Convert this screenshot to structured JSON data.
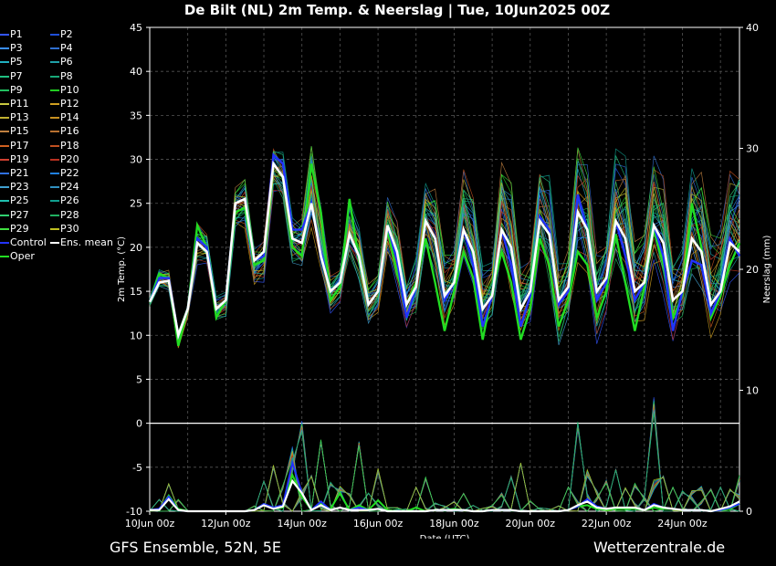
{
  "title": "De Bilt  (NL)  2m Temp. & Neerslag | Tue, 10Jun2025 00Z",
  "footer": {
    "left": "GFS Ensemble, 52N, 5E",
    "right": "Wetterzentrale.de"
  },
  "legend": [
    "P1",
    "P2",
    "P3",
    "P4",
    "P5",
    "P6",
    "P7",
    "P8",
    "P9",
    "P10",
    "P11",
    "P12",
    "P13",
    "P14",
    "P15",
    "P16",
    "P17",
    "P18",
    "P19",
    "P20",
    "P21",
    "P22",
    "P23",
    "P24",
    "P25",
    "P26",
    "P27",
    "P28",
    "P29",
    "P30",
    "Control",
    "Ens. mean",
    "Oper"
  ],
  "legend_colors": [
    "#3355ff",
    "#1f4fd8",
    "#3a8fff",
    "#2f6fd0",
    "#20b0c0",
    "#1fa0a8",
    "#20c080",
    "#18a878",
    "#22c060",
    "#22cc22",
    "#c8c840",
    "#d0a020",
    "#c0b030",
    "#c89020",
    "#c08040",
    "#b87030",
    "#d06020",
    "#c05020",
    "#d04030",
    "#b83020",
    "#3070e0",
    "#2080e0",
    "#40a0d0",
    "#3090c0",
    "#20c0b0",
    "#10a090",
    "#30d070",
    "#20b060",
    "#40e040",
    "#c0c020",
    "#2233ff",
    "#ffffff",
    "#22dd22"
  ],
  "chart_data": {
    "type": "line",
    "xlabel": "Date (UTC)",
    "ylabel": "2m Temp. (°C)",
    "y2label": "Neerslag (mm)",
    "ylim": [
      -10,
      45
    ],
    "y2lim": [
      0,
      40
    ],
    "yticks": [
      "-10",
      "-5",
      "0",
      "5",
      "10",
      "15",
      "20",
      "25",
      "30",
      "35",
      "40",
      "45"
    ],
    "y2ticks": [
      "0",
      "10",
      "20",
      "30",
      "40"
    ],
    "xlim": [
      0,
      15.5
    ],
    "xticks": [
      {
        "day": 0,
        "label": "10Jun 00z"
      },
      {
        "day": 2,
        "label": "12Jun 00z"
      },
      {
        "day": 4,
        "label": "14Jun 00z"
      },
      {
        "day": 6,
        "label": "16Jun 00z"
      },
      {
        "day": 8,
        "label": "18Jun 00z"
      },
      {
        "day": 10,
        "label": "20Jun 00z"
      },
      {
        "day": 12,
        "label": "22Jun 00z"
      },
      {
        "day": 14,
        "label": "24Jun 00z"
      }
    ],
    "grid": true,
    "legend_position": "left outside",
    "step_hours": 6,
    "temp_ens_mean": [
      13.8,
      16,
      16.2,
      10,
      13,
      20.5,
      19.5,
      13,
      14,
      25,
      25.5,
      18.5,
      19.5,
      29.5,
      28,
      21,
      20.5,
      25,
      19,
      15,
      16,
      21.5,
      19,
      13.5,
      15,
      22.5,
      19.5,
      13.5,
      15.5,
      23,
      21,
      14.5,
      16,
      22,
      19.5,
      13,
      14.5,
      22,
      20,
      13,
      15,
      23,
      21.5,
      14,
      15.5,
      24,
      22,
      15,
      16.5,
      23,
      21,
      15,
      16,
      22.5,
      20.5,
      14,
      15,
      21,
      19.5,
      13.5,
      15,
      20.5,
      19.5
    ],
    "temp_control": [
      13.8,
      16.5,
      16.5,
      10,
      13,
      21,
      20,
      13,
      14,
      25,
      25.5,
      18.5,
      19,
      30.5,
      29.5,
      22,
      22,
      25,
      19.5,
      15,
      16,
      21.5,
      19,
      13.5,
      15,
      22.5,
      18.5,
      12,
      15.5,
      23,
      21,
      14,
      16,
      22,
      18,
      11,
      14.5,
      22,
      18,
      11,
      14.5,
      23.5,
      22,
      13.5,
      15,
      26,
      22,
      14,
      16,
      23,
      19,
      14,
      16,
      22.5,
      19,
      10.5,
      15,
      18.5,
      18,
      12.5,
      15,
      21,
      19
    ],
    "temp_oper": [
      13.8,
      17,
      16.5,
      8.8,
      13,
      22.5,
      20,
      12,
      14,
      24,
      24.5,
      18,
      18.5,
      29.5,
      28,
      20,
      19,
      29.5,
      24,
      14,
      15.5,
      25.5,
      18.5,
      13.5,
      15,
      22,
      17,
      13.5,
      16,
      21,
      16,
      10.5,
      15,
      19.5,
      16.5,
      9.5,
      15,
      19.5,
      16,
      9.5,
      13,
      21,
      18,
      11,
      14,
      19.5,
      18,
      12,
      15,
      21.5,
      16,
      10.5,
      15.5,
      22,
      18,
      12,
      14.5,
      25,
      20,
      12,
      14.5,
      18,
      20.5
    ],
    "temp_env_min": [
      13.2,
      15.5,
      15,
      8.5,
      12,
      18,
      18,
      11.5,
      12,
      22,
      22,
      15.5,
      16,
      26,
      25,
      18,
      17.5,
      22,
      17,
      12.5,
      13.5,
      18.5,
      16,
      11,
      12.5,
      19,
      15.5,
      10.5,
      12,
      20,
      16.5,
      11,
      13,
      19,
      15,
      10,
      12,
      19,
      14.5,
      10,
      11.5,
      19,
      15,
      8.5,
      11.5,
      18,
      16,
      9,
      12,
      17.5,
      15,
      10,
      11.5,
      17,
      14.5,
      8.5,
      11.5,
      16.5,
      14,
      9.5,
      11.5,
      16,
      16
    ],
    "temp_env_max": [
      14.2,
      17.5,
      17.5,
      10.5,
      13.5,
      23,
      22,
      14.5,
      15,
      27,
      28,
      20,
      21,
      32,
      31,
      23.5,
      23.5,
      32,
      25,
      17,
      18,
      25.5,
      22.5,
      16,
      17,
      26,
      23.5,
      16.5,
      19,
      27.5,
      27,
      19.5,
      20,
      29.5,
      27.5,
      18,
      18.5,
      30,
      28,
      18,
      19,
      30,
      28.5,
      18.5,
      20,
      32,
      30,
      20,
      21.5,
      31.5,
      31,
      21,
      22,
      31,
      29,
      19.5,
      20,
      29.5,
      29,
      22,
      22.5,
      29.5,
      30
    ],
    "precip_ens_mean": [
      0.1,
      0.1,
      1,
      0.1,
      0,
      0,
      0,
      0,
      0,
      0,
      0,
      0.1,
      0.5,
      0.2,
      0.4,
      2.5,
      1.5,
      0.1,
      0.5,
      0.1,
      0.3,
      0.1,
      0.1,
      0.1,
      0.2,
      0,
      0,
      0,
      0,
      0,
      0.1,
      0.1,
      0.1,
      0.1,
      0,
      0,
      0.1,
      0.1,
      0.1,
      0,
      0,
      0,
      0,
      0,
      0.1,
      0.5,
      0.8,
      0.3,
      0.2,
      0.3,
      0.3,
      0.3,
      0.1,
      0.5,
      0.3,
      0.2,
      0.1,
      0.1,
      0.1,
      0,
      0.2,
      0.4,
      0.8
    ],
    "precip_control": [
      0.1,
      0.2,
      1.2,
      0.1,
      0,
      0,
      0,
      0,
      0,
      0,
      0,
      0.1,
      0.6,
      0.3,
      0.5,
      4,
      1.5,
      0.1,
      0.8,
      0.1,
      0.3,
      0.1,
      0.3,
      0.1,
      0.2,
      0,
      0,
      0,
      0,
      0,
      0.1,
      0.1,
      0.1,
      0.1,
      0,
      0,
      0.1,
      0.1,
      0.1,
      0,
      0,
      0,
      0,
      0,
      0.1,
      0.4,
      1,
      0.4,
      0.2,
      0.3,
      0.3,
      0.3,
      0.1,
      0.6,
      0.3,
      0.2,
      0.1,
      0.1,
      0.1,
      0,
      0.1,
      0.3,
      0.6
    ],
    "precip_oper": [
      0.1,
      0.1,
      1.3,
      0.2,
      0,
      0,
      0,
      0,
      0,
      0,
      0,
      0.1,
      0.6,
      0.2,
      0.3,
      3,
      1.2,
      0.1,
      0.6,
      0.2,
      1.5,
      0.1,
      0.5,
      0.1,
      0.9,
      0.1,
      0,
      0,
      0.3,
      0,
      0.1,
      0.1,
      0.2,
      0.1,
      0,
      0,
      0.1,
      0.1,
      0.1,
      0,
      0,
      0,
      0,
      0,
      0.1,
      0.4,
      0.5,
      0.2,
      0.1,
      0.2,
      0.2,
      0.2,
      0.1,
      0.3,
      0.2,
      0.2,
      0.1,
      0.1,
      0.1,
      0,
      0.1,
      0.2,
      0.6
    ],
    "precip_env_max": [
      0.2,
      1,
      2.3,
      1.2,
      0.1,
      0,
      0,
      0,
      0,
      0,
      0,
      0.5,
      2.5,
      4,
      3,
      10,
      9,
      3,
      6,
      3,
      4,
      2,
      6,
      1.5,
      4,
      0.5,
      0.5,
      0.2,
      2,
      3,
      1,
      0.8,
      1,
      1.5,
      0.5,
      0.3,
      1,
      2,
      3,
      4,
      1,
      0.5,
      0.3,
      0.5,
      2,
      8,
      5,
      3,
      3,
      3.5,
      2,
      3,
      2.5,
      12,
      3,
      2,
      2,
      3,
      3,
      2,
      2,
      2,
      4.5
    ]
  }
}
